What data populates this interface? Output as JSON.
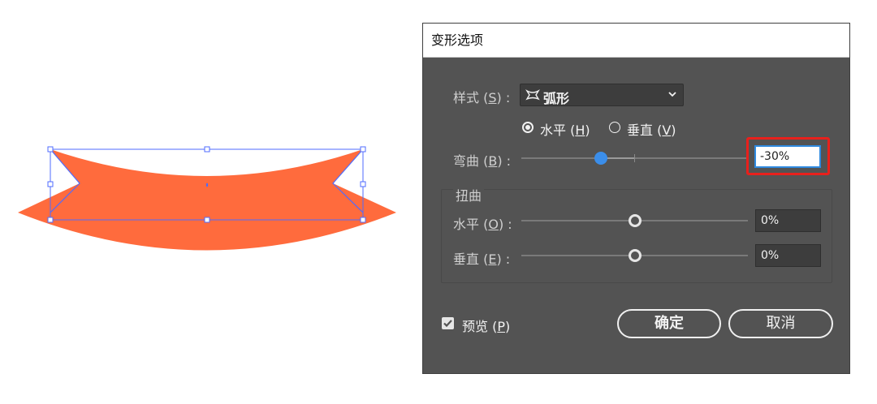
{
  "dialog": {
    "title": "变形选项",
    "style": {
      "label": "样式",
      "mnemonic": "S",
      "value": "弧形",
      "icon": "arc-icon"
    },
    "orientation": {
      "horizontal_label": "水平",
      "horizontal_mnemonic": "H",
      "vertical_label": "垂直",
      "vertical_mnemonic": "V",
      "selected": "horizontal"
    },
    "bend": {
      "label": "弯曲",
      "mnemonic": "B",
      "value": "-30%",
      "level": -30
    },
    "distortion": {
      "title": "扭曲",
      "horizontal": {
        "label": "水平",
        "mnemonic": "O",
        "value": "0%",
        "level": 0
      },
      "vertical": {
        "label": "垂直",
        "mnemonic": "E",
        "value": "0%",
        "level": 0
      }
    },
    "preview": {
      "label": "预览",
      "mnemonic": "P",
      "checked": true
    },
    "ok_label": "确定",
    "cancel_label": "取消"
  },
  "colors": {
    "shape_fill": "#ff6b3d",
    "selection": "#4f6bff",
    "highlight_box": "#e8201c",
    "slider_active": "#3b8eea",
    "dialog_bg": "#535353"
  }
}
